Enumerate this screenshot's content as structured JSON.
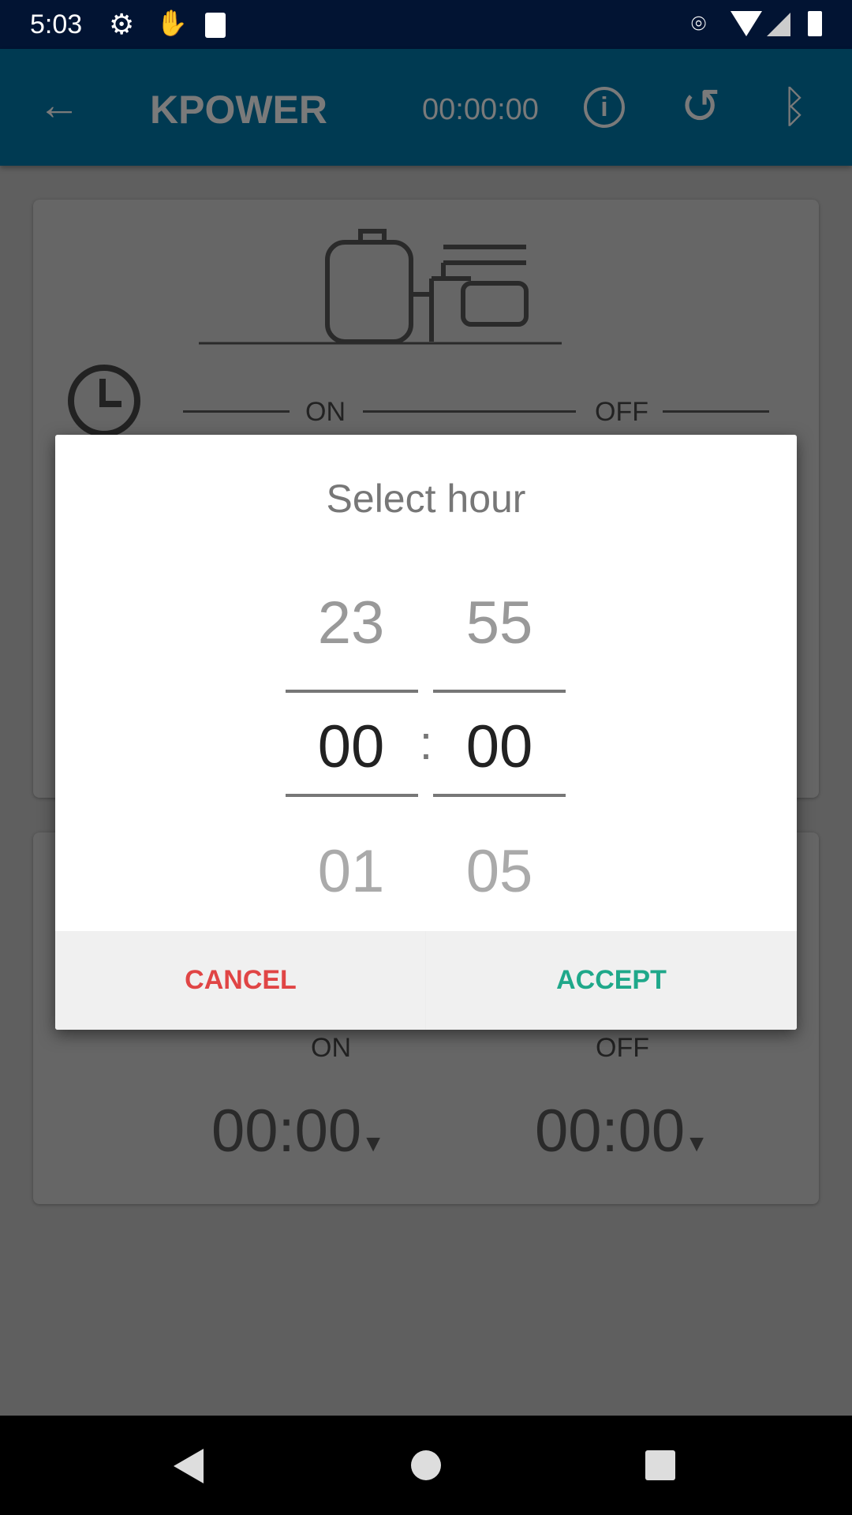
{
  "status_bar": {
    "time": "5:03",
    "icons": [
      "gear-icon",
      "hand-icon",
      "sd-card-icon",
      "location-icon",
      "wifi-icon",
      "signal-icon",
      "battery-charging-icon"
    ]
  },
  "app_bar": {
    "title": "KPOWER",
    "timer": "00:00:00",
    "icons": [
      "back-arrow-icon",
      "info-icon",
      "refresh-icon",
      "bluetooth-icon"
    ],
    "color": "#0090c8"
  },
  "card1": {
    "on_label": "ON",
    "off_label": "OFF"
  },
  "card2": {
    "on_label": "ON",
    "off_label": "OFF",
    "on_time": "00:00",
    "off_time": "00:00"
  },
  "dialog": {
    "title": "Select hour",
    "hour": {
      "prev": "23",
      "selected": "00",
      "next": "01"
    },
    "minute": {
      "prev": "55",
      "selected": "00",
      "next": "05"
    },
    "separator": ":",
    "cancel_label": "CANCEL",
    "accept_label": "ACCEPT",
    "cancel_color": "#e04545",
    "accept_color": "#1fa88a"
  }
}
